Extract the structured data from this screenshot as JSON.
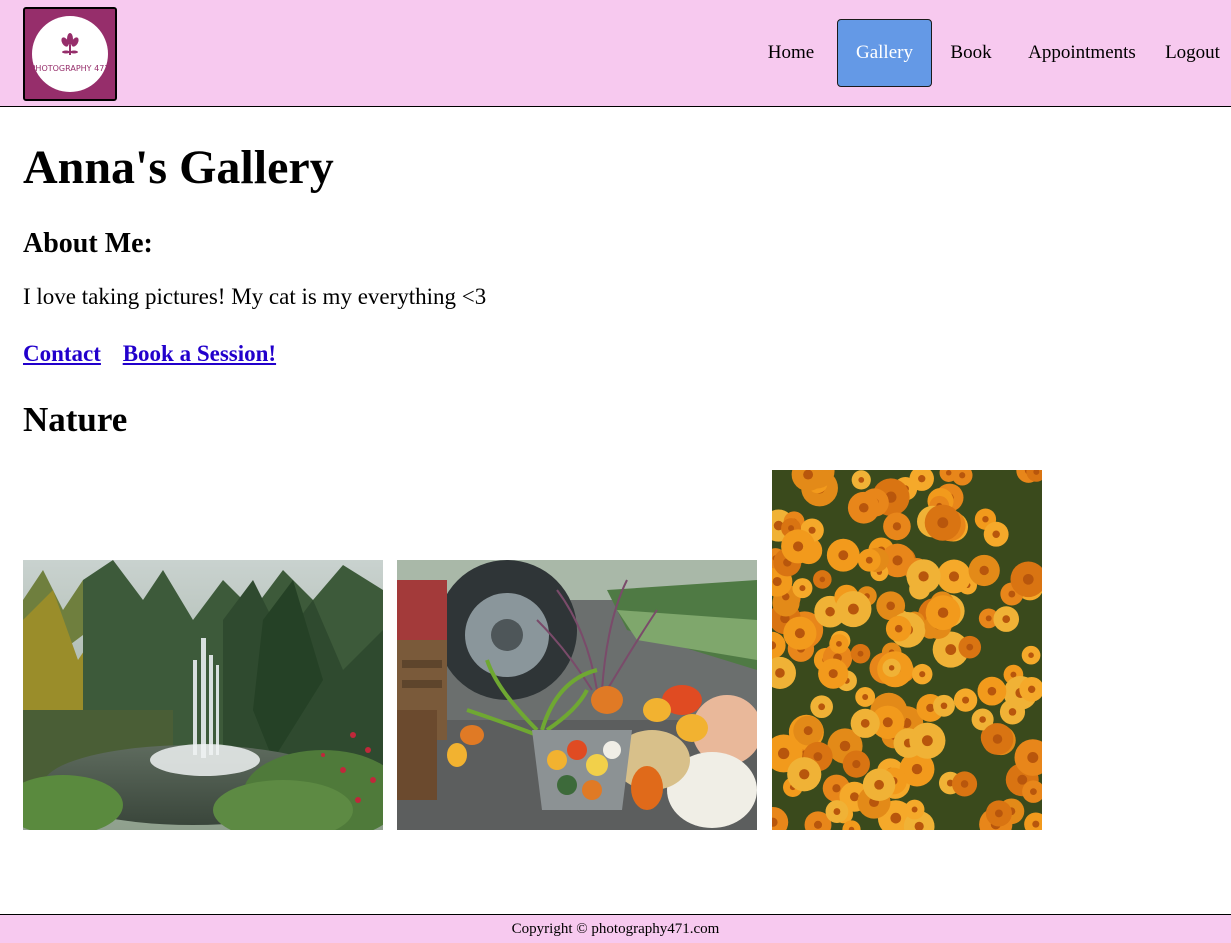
{
  "header": {
    "logo_text": "PHOTOGRAPHY 471",
    "nav": [
      {
        "label": "Home",
        "active": false
      },
      {
        "label": "Gallery",
        "active": true
      },
      {
        "label": "Book",
        "active": false
      },
      {
        "label": "Appointments",
        "active": false
      },
      {
        "label": "Logout",
        "active": false
      }
    ]
  },
  "main": {
    "title": "Anna's Gallery",
    "about_heading": "About Me:",
    "about_text": "I love taking pictures! My cat is my everything <3",
    "links": [
      {
        "label": "Contact"
      },
      {
        "label": "Book a Session!"
      }
    ],
    "section_heading": "Nature",
    "photos": [
      {
        "subject": "waterfall-fountain-forest"
      },
      {
        "subject": "pumpkins-tractor-garden"
      },
      {
        "subject": "orange-chrysanthemums"
      }
    ]
  },
  "footer": {
    "copyright": "Copyright © photography471.com"
  },
  "colors": {
    "header_bg": "#f7c9ef",
    "active_nav": "#6499e6",
    "logo_bg": "#962e6b",
    "link": "#2200cc"
  }
}
